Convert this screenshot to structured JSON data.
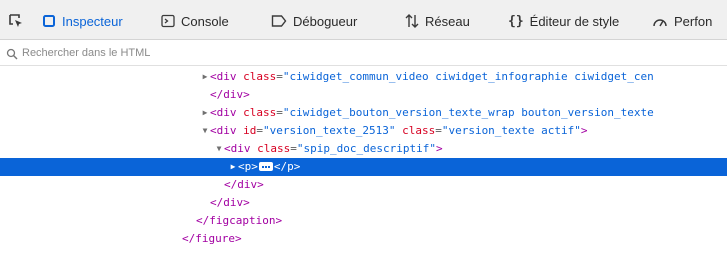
{
  "toolbar": {
    "pick_icon": "element-picker-icon",
    "tabs": [
      {
        "label": "Inspecteur",
        "icon": "inspector-icon"
      },
      {
        "label": "Console",
        "icon": "console-icon"
      },
      {
        "label": "Débogueur",
        "icon": "debugger-icon"
      },
      {
        "label": "Réseau",
        "icon": "network-icon"
      },
      {
        "label": "Éditeur de style",
        "icon": "style-editor-icon"
      },
      {
        "label": "Perfon",
        "icon": "performance-icon"
      }
    ],
    "active_color": "#0a64d8"
  },
  "search": {
    "placeholder": "Rechercher dans le HTML",
    "value": ""
  },
  "tree": {
    "selection_color": "#0a64d8",
    "nodes": [
      {
        "twisty": "collapsed",
        "open": "<div ",
        "attr1": "class",
        "val1": "\"ciwidget_commun_video ciwidget_infographie ciwidget_cen"
      },
      {
        "close": "</div>"
      },
      {
        "twisty": "collapsed",
        "open": "<div ",
        "attr1": "class",
        "val1": "\"ciwidget_bouton_version_texte_wrap bouton_version_texte"
      },
      {
        "twisty": "expanded",
        "open": "<div ",
        "attr1": "id",
        "val1": "\"version_texte_2513\"",
        "attr2": "class",
        "val2": "\"version_texte actif\"",
        "end": ">"
      },
      {
        "twisty": "expanded",
        "open": "<div ",
        "attr1": "class",
        "val1": "\"spip_doc_descriptif\"",
        "end": ">"
      },
      {
        "twisty": "collapsed",
        "open": "<p>",
        "close": "</p>",
        "selected": true
      },
      {
        "close": "</div>"
      },
      {
        "close": "</div>"
      },
      {
        "close": "</figcaption>"
      },
      {
        "close": "</figure>"
      }
    ]
  }
}
